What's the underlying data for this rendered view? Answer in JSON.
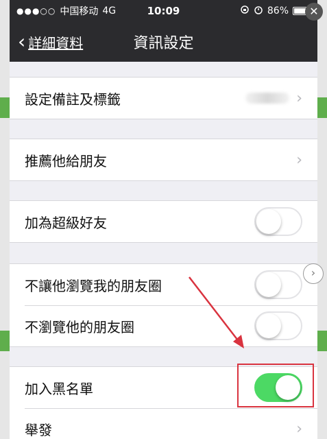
{
  "status_bar": {
    "signal_dots": "●●●○○",
    "carrier": "中国移动",
    "network": "4G",
    "time": "10:09",
    "battery_percent": "86%",
    "battery_level": 0.86
  },
  "nav": {
    "back_label": "詳細資料",
    "title": "資訊設定"
  },
  "settings": {
    "remark_label": "設定備註及標籤",
    "recommend_label": "推薦他給朋友",
    "star_friend_label": "加為超級好友",
    "star_friend_on": false,
    "hide_moments_label": "不讓他瀏覽我的朋友圈",
    "hide_moments_on": false,
    "dont_view_label": "不瀏覽他的朋友圈",
    "dont_view_on": false,
    "blacklist_label": "加入黑名單",
    "blacklist_on": true,
    "report_label": "舉發"
  },
  "icons": {
    "back": "chevron-left-icon",
    "disclosure": "chevron-right-icon",
    "alarm": "alarm-icon",
    "lock_rotation": "rotation-lock-icon",
    "close": "close-icon"
  },
  "colors": {
    "nav_bg": "#2b2b2e",
    "toggle_on": "#4cd964",
    "annotation": "#d9333f"
  }
}
